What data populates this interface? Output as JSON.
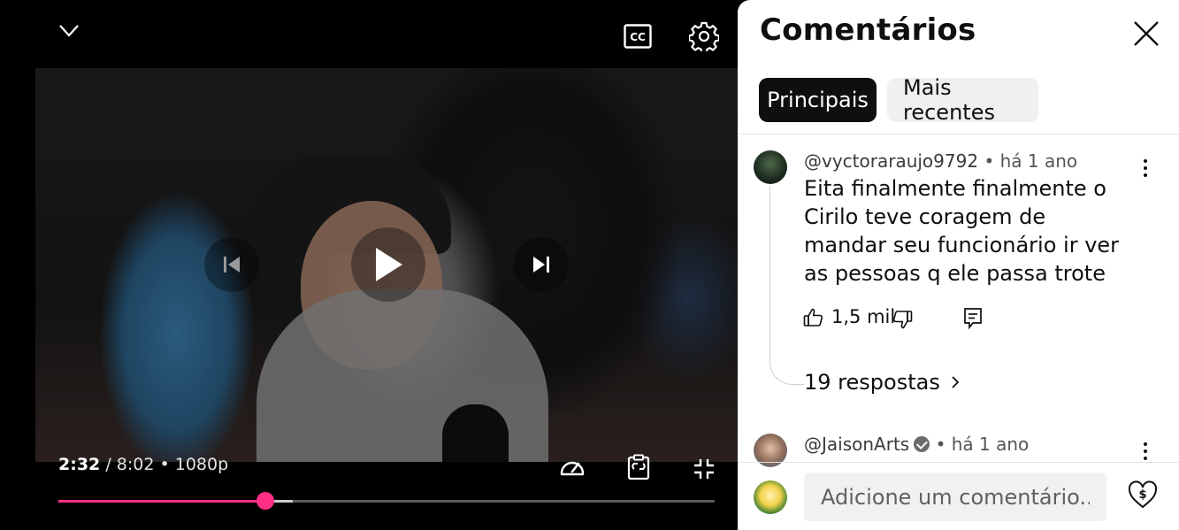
{
  "player": {
    "time_current": "2:32",
    "time_separator": "/",
    "time_total": "8:02",
    "quality": "• 1080p",
    "progress_fraction": 0.316,
    "buffer_fraction": 0.357,
    "accent_color": "#ff2f84",
    "icons": {
      "collapse": "chevron-down-icon",
      "captions": "closed-captions-icon",
      "settings": "gear-icon",
      "previous": "skip-previous-icon",
      "play": "play-icon",
      "next": "skip-next-icon",
      "speed": "playback-speed-icon",
      "clip": "clip-icon",
      "exit_fullscreen": "exit-fullscreen-icon"
    }
  },
  "comments": {
    "title": "Comentários",
    "chips": [
      "Principais",
      "Mais recentes"
    ],
    "active_chip": "Principais",
    "items": [
      {
        "author": "@vyctoraraujo9792",
        "meta": "• há 1 ano",
        "text": "Eita finalmente finalmente o Cirilo teve coragem de mandar seu funcionário ir ver as pessoas q ele passa trote",
        "likes": "1,5 mil",
        "replies": "19 respostas"
      },
      {
        "author": "@JaisonArts",
        "verified": true,
        "meta": "• há 1 ano"
      }
    ],
    "composer": {
      "placeholder": "Adicione um comentário..."
    }
  }
}
